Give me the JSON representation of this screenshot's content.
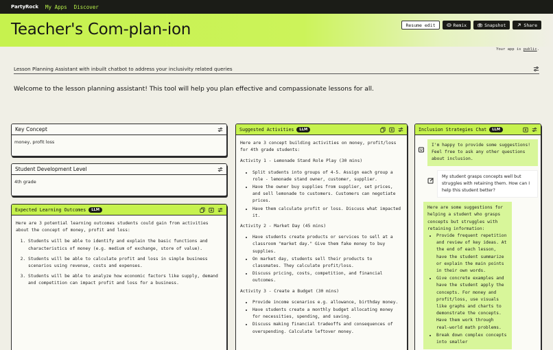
{
  "nav": {
    "brand": "PartyRock",
    "links": [
      "My Apps",
      "Discover"
    ]
  },
  "header": {
    "title": "Teacher's Com-plan-ion",
    "buttons": {
      "resume": "Resume edit",
      "remix": "Remix",
      "snapshot": "Snapshot",
      "share": "Share"
    },
    "public_prefix": "Your app is ",
    "public_link": "public",
    "public_suffix": "."
  },
  "description": "Lesson Planning Assistant with inbuilt chatbot to address your inclusivity related queries",
  "welcome": "Welcome to the lesson planning assistant! This tool will help you plan effective and compassionate lessons for all.",
  "widgets": {
    "key_concept": {
      "title": "Key Concept",
      "value": "money, profit loss"
    },
    "student_level": {
      "title": "Student Development Level",
      "value": "4th grade"
    },
    "outcomes": {
      "title": "Expected Learning Outcomes",
      "badge": "LLM",
      "intro": "Here are 3 potential learning outcomes students could gain from activities about the concept of money, profit and loss:",
      "items": [
        "Students will be able to identify and explain the basic functions and characteristics of money (e.g. medium of exchange, store of value).",
        "Students will be able to calculate profit and loss in simple business scenarios using revenue, costs and expenses.",
        "Students will be able to analyze how economic factors like supply, demand and competition can impact profit and loss for a business."
      ]
    },
    "activities": {
      "title": "Suggested Activities",
      "badge": "LLM",
      "intro": "Here are 3 concept building activities on money, profit/loss for 4th grade students:",
      "sections": [
        {
          "heading": "Activity 1 - Lemonade Stand Role Play (30 mins)",
          "bullets": [
            "Split students into groups of 4-5. Assign each group a role - lemonade stand owner, customer, supplier.",
            "Have the owner buy supplies from supplier, set prices, and sell lemonade to customers. Customers can negotiate prices.",
            "Have them calculate profit or loss. Discuss what impacted it."
          ]
        },
        {
          "heading": "Activity 2 - Market Day (45 mins)",
          "bullets": [
            "Have students create products or services to sell at a classroom \"market day.\" Give them fake money to buy supplies.",
            "On market day, students sell their products to classmates. They calculate profit/loss.",
            "Discuss pricing, costs, competition, and financial outcomes."
          ]
        },
        {
          "heading": "Activity 3 - Create a Budget (30 mins)",
          "bullets": [
            "Provide income scenarios e.g. allowance, birthday money.",
            "Have students create a monthly budget allocating money for necessities, spending, and saving.",
            "Discuss making financial tradeoffs and consequences of overspending. Calculate leftover money."
          ]
        }
      ]
    },
    "chat": {
      "title": "Inclusion Strategies Chat",
      "badge": "LLM",
      "ai_greeting": "I'm happy to provide some suggestions! Feel free to ask any other questions about inclusion.",
      "user_msg": "My student grasps concepts well but struggles with retaining them. How can I help this student better?",
      "ai_reply_intro": "Here are some suggestions for helping a student who grasps concepts but struggles with retaining information:",
      "ai_reply_bullets": [
        "Provide frequent repetition and review of key ideas. At the end of each lesson, have the student summarize or explain the main points in their own words.",
        "Give concrete examples and have the student apply the concepts. For money and profit/loss, use visuals like graphs and charts to demonstrate the concepts. Have them work through real-world math problems.",
        "Break down complex concepts into smaller"
      ]
    }
  },
  "colors": {
    "accent": "#c6f24e",
    "dark": "#1b1c17",
    "background": "#f0efe6"
  }
}
